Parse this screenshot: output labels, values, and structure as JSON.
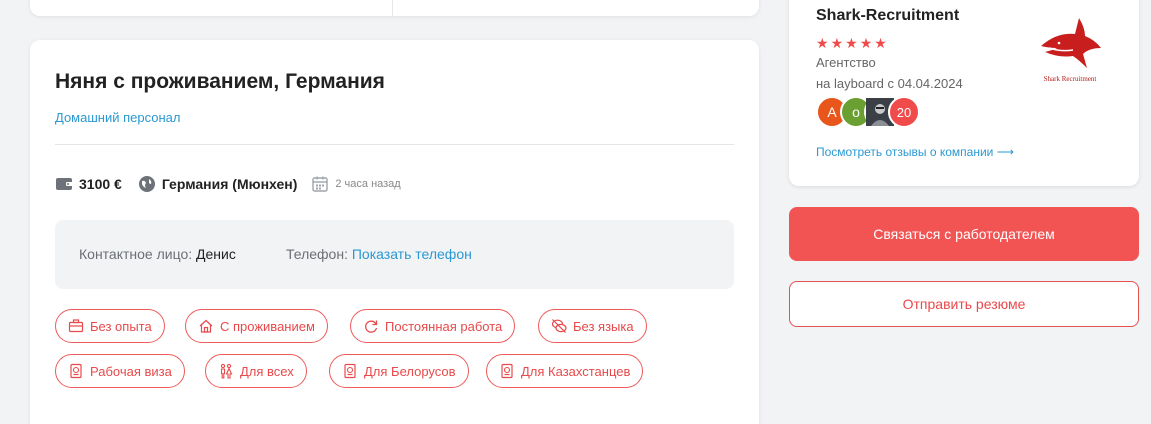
{
  "job": {
    "title": "Няня с проживанием, Германия",
    "category": "Домашний персонал",
    "salary": "3100 €",
    "location": "Германия (Мюнхен)",
    "posted": "2 часа назад"
  },
  "contact": {
    "person_label": "Контактное лицо:",
    "person_name": "Денис",
    "phone_label": "Телефон:",
    "phone_link": "Показать телефон"
  },
  "tags": [
    {
      "label": "Без опыта",
      "icon": "briefcase-icon"
    },
    {
      "label": "С проживанием",
      "icon": "house-icon"
    },
    {
      "label": "Постоянная работа",
      "icon": "refresh-icon"
    },
    {
      "label": "Без языка",
      "icon": "speech-bubbles-icon"
    },
    {
      "label": "Рабочая виза",
      "icon": "passport-icon"
    },
    {
      "label": "Для всех",
      "icon": "people-icon"
    },
    {
      "label": "Для Белорусов",
      "icon": "passport-icon"
    },
    {
      "label": "Для Казахстанцев",
      "icon": "passport-icon"
    }
  ],
  "company": {
    "name": "Shark-Recruitment",
    "rating": 5,
    "type": "Агентство",
    "since": "на layboard с 04.04.2024",
    "logo_text": "Shark Recruitment",
    "avatars": [
      "А",
      "о"
    ],
    "review_count": "20",
    "reviews_link": "Посмотреть отзывы о компании ⟶"
  },
  "actions": {
    "contact_employer": "Связаться с работодателем",
    "send_resume": "Отправить резюме"
  },
  "colors": {
    "accent": "#f25454",
    "link": "#2a98d2",
    "background": "#f2f3f5"
  }
}
